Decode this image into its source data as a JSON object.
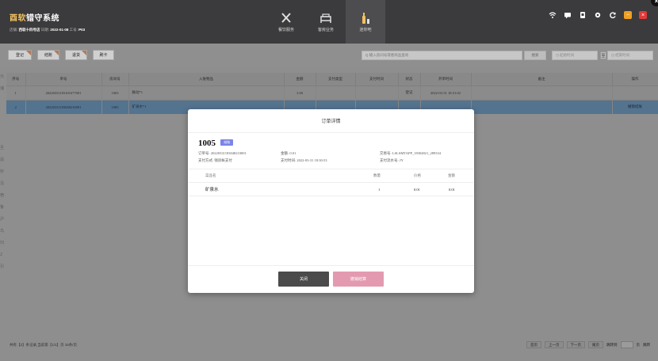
{
  "app": {
    "brand_part1": "酉软",
    "brand_part2": "错守系统",
    "store_label": "店铺:",
    "store_name": "西软十四号店",
    "session_label": "日期:",
    "session_date": "2022-01-08",
    "pos_label": "工号:",
    "pos_id": "P03"
  },
  "nav": {
    "items": [
      {
        "label": "餐饮服务",
        "icon": "utensils-icon"
      },
      {
        "label": "客房业务",
        "icon": "bed-icon"
      },
      {
        "label": "迷你吧",
        "icon": "minibar-icon"
      }
    ]
  },
  "toolbar": {
    "buttons": [
      "登记",
      "结账",
      "退货",
      "刷卡"
    ],
    "search_placeholder": "Q 输入房间号或者商品查询",
    "search_button": "搜索",
    "date_start": "◷ 起始时间",
    "date_separator": "至",
    "date_end": "◷ 结束时间"
  },
  "table": {
    "headers": [
      "序号",
      "单号",
      "房间号",
      "入账物品",
      "金额",
      "支付类型",
      "支付时间",
      "状态",
      "开单时间",
      "备注",
      "操作"
    ],
    "rows": [
      {
        "no": "1",
        "order": "20220331183101677001",
        "room": "1003",
        "items": "脉动*1",
        "amount": "3.00",
        "pay_type": "",
        "pay_time": "",
        "status": "登记",
        "open_time": "2022-03-31 18:31:02",
        "note": "",
        "op": ""
      },
      {
        "no": "2",
        "order": "20220331183048210001",
        "room": "1005",
        "items": "矿泉水*1",
        "amount": "",
        "pay_type": "",
        "pay_time": "",
        "status": "",
        "open_time": "",
        "note": "",
        "op": "撤销结账"
      }
    ]
  },
  "left_glyphs": [
    "元",
    "浦",
    "旦",
    "渝",
    "秒",
    "沿",
    "宿",
    "鲁",
    "沪",
    "鸟",
    "归",
    "2",
    "引"
  ],
  "footer": {
    "info": "共有【2】条记录,当前第【1/1】页 15条/页",
    "first": "首页",
    "prev": "上一页",
    "next": "下一页",
    "last": "尾页",
    "jump_label": "跳转到",
    "page_suffix": "页",
    "jump_button": "跳转"
  },
  "modal": {
    "title": "订单详情",
    "room": "1005",
    "status_badge": "结账",
    "order_no": "订单号: 20220331183048210001",
    "amount": "金额: 0.01",
    "trade_no": "交易号: LSLSMTAPP_18304821_289334",
    "pay_method": "支付方式: 钱房帐支付",
    "pay_time": "支付时间: 2022-03-31 18:30:53",
    "serial_no": "支付流水号: JY",
    "item_headers": {
      "name": "菜品名",
      "qty": "数量",
      "price": "价格",
      "total": "金额"
    },
    "items": [
      {
        "name": "矿泉水",
        "qty": "1",
        "price": "0.01",
        "total": "0.01"
      }
    ],
    "close_button": "关闭",
    "refund_button": "撤销结算"
  },
  "colors": {
    "brand_gold": "#f0c060",
    "badge": "#7b84e6",
    "close_btn": "#4b4b4b",
    "refund_btn": "#e39ab0",
    "selected_row": "#54738f"
  }
}
